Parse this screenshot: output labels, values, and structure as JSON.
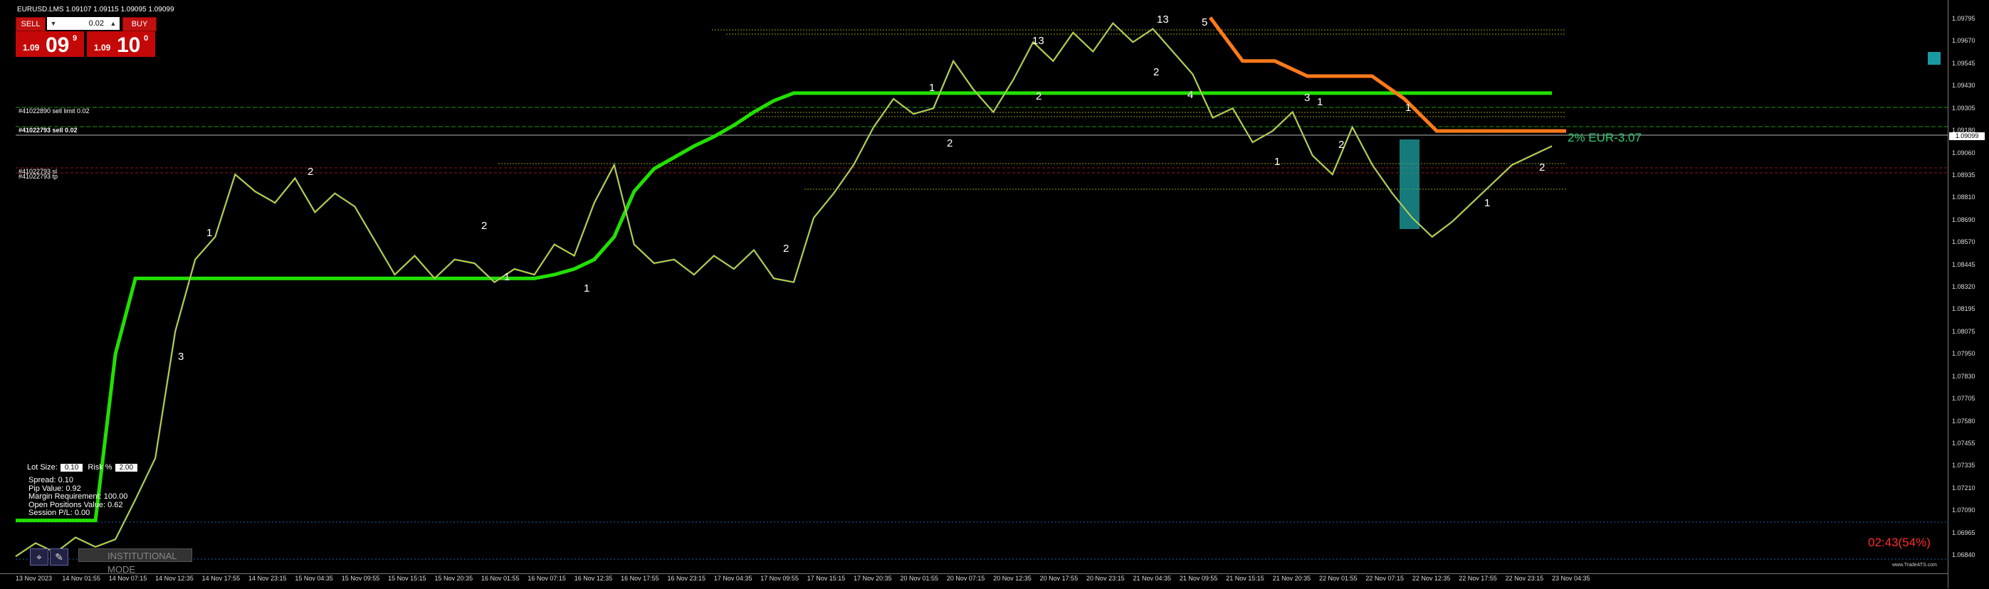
{
  "symbol": "EURUSD.LMS  1.09107 1.09115 1.09095 1.09099",
  "trade_panel": {
    "sell_label": "SELL",
    "buy_label": "BUY",
    "lot_value": "0.02",
    "bid_small": "1.09",
    "bid_big": "09",
    "bid_sup": "9",
    "ask_small": "1.09",
    "ask_big": "10",
    "ask_sup": "0"
  },
  "order_labels": [
    {
      "text": "#41022890 sell limit 0.02"
    },
    {
      "text": "#41022793 sell 0.02"
    },
    {
      "text": "#41022793 sl"
    },
    {
      "text": "#41022793 tp"
    }
  ],
  "risk": {
    "lot_label": "Lot Size:",
    "lot_value": "0.10",
    "risk_label": "Risk %",
    "risk_value": "2.00"
  },
  "info_lines": [
    "Spread: 0.10",
    "Pip Value: 0.92",
    "Margin Requirement: 100.00",
    "Open Positions Value: 0.62",
    "Session P/L: 0.00"
  ],
  "institutional_label": "INSTITUTIONAL MODE",
  "result_label": "2% EUR-3.07",
  "timer": "02:43(54%)",
  "brand": "www.TradeATS.com",
  "current_price": "1.09099",
  "colors": {
    "price": "#f0e000",
    "price_alt": "#1e90ff",
    "trend_green": "#22e000",
    "trend_orange": "#ff7a1a",
    "level_red": "#cc2222",
    "level_cyan": "#1e90ff",
    "level_yellow": "#d8d800",
    "position_box": "#1fa3a3",
    "result_text": "#2ecc71",
    "timer": "#ff2a2a"
  },
  "chart_data": {
    "type": "line",
    "title": "",
    "xlabel": "",
    "ylabel": "",
    "ylim": [
      1.0684,
      1.0982
    ],
    "y_ticks": [
      "1.09795",
      "1.09670",
      "1.09545",
      "1.09430",
      "1.09305",
      "1.09180",
      "1.09060",
      "1.08935",
      "1.08810",
      "1.08690",
      "1.08570",
      "1.08445",
      "1.08320",
      "1.08195",
      "1.08075",
      "1.07950",
      "1.07830",
      "1.07705",
      "1.07580",
      "1.07455",
      "1.07335",
      "1.07210",
      "1.07090",
      "1.06965",
      "1.06840"
    ],
    "x_ticks": [
      "13 Nov 2023",
      "14 Nov 01:55",
      "14 Nov 07:15",
      "14 Nov 12:35",
      "14 Nov 17:55",
      "14 Nov 23:15",
      "15 Nov 04:35",
      "15 Nov 09:55",
      "15 Nov 15:15",
      "15 Nov 20:35",
      "16 Nov 01:55",
      "16 Nov 07:15",
      "16 Nov 12:35",
      "16 Nov 17:55",
      "16 Nov 23:15",
      "17 Nov 04:35",
      "17 Nov 09:55",
      "17 Nov 15:15",
      "17 Nov 20:35",
      "20 Nov 01:55",
      "20 Nov 07:15",
      "20 Nov 12:35",
      "20 Nov 17:55",
      "20 Nov 23:15",
      "21 Nov 04:35",
      "21 Nov 09:55",
      "21 Nov 15:15",
      "21 Nov 20:35",
      "22 Nov 01:55",
      "22 Nov 07:15",
      "22 Nov 12:35",
      "22 Nov 17:55",
      "22 Nov 23:15",
      "23 Nov 04:35"
    ],
    "series": [
      {
        "values": [
          1.0693,
          1.07,
          1.0695,
          1.0703,
          1.0698,
          1.0702,
          1.0723,
          1.0745,
          1.0812,
          1.085,
          1.0862,
          1.0895,
          1.0886,
          1.088,
          1.0893,
          1.0875,
          1.0885,
          1.0878,
          1.086,
          1.0842,
          1.0852,
          1.084,
          1.085,
          1.0848,
          1.0838,
          1.0845,
          1.0842,
          1.0858,
          1.0852,
          1.088,
          1.09,
          1.0858,
          1.0848,
          1.085,
          1.0842,
          1.0852,
          1.0845,
          1.0855,
          1.084,
          1.0838,
          1.0872,
          1.0885,
          1.09,
          1.092,
          1.0935,
          1.0927,
          1.093,
          1.0955,
          1.094,
          1.0928,
          1.0945,
          1.0965,
          1.0955,
          1.097,
          1.096,
          1.0975,
          1.0965,
          1.0972,
          1.096,
          1.0948,
          1.0925,
          1.093,
          1.0912,
          1.0918,
          1.0928,
          1.0905,
          1.0895,
          1.092,
          1.09,
          1.0885,
          1.0872,
          1.0862,
          1.087,
          1.088,
          1.089,
          1.09,
          1.0905,
          1.091
        ]
      },
      {
        "values": [
          1.0712,
          1.0712,
          1.0712,
          1.0712,
          1.0712,
          1.08,
          1.084,
          1.084,
          1.084,
          1.084,
          1.084,
          1.084,
          1.084,
          1.084,
          1.084,
          1.084,
          1.084,
          1.084,
          1.084,
          1.084,
          1.084,
          1.084,
          1.084,
          1.084,
          1.084,
          1.084,
          1.084,
          1.0842,
          1.0845,
          1.085,
          1.0862,
          1.0886,
          1.0898,
          1.0904,
          1.091,
          1.0915,
          1.0921,
          1.0928,
          1.0934,
          1.0938,
          1.0938,
          1.0938,
          1.0938,
          1.0938,
          1.0938,
          1.0938,
          1.0938,
          1.0938,
          1.0938,
          1.0938,
          1.0938,
          1.0938,
          1.0938,
          1.0938,
          1.0938,
          1.0938,
          1.0938,
          1.0938,
          1.0938,
          1.0938,
          1.0938,
          1.0938,
          1.0938,
          1.0938,
          1.0938,
          1.0938,
          1.0938,
          1.0938,
          1.0938,
          1.0938,
          1.0938,
          1.0938,
          1.0938,
          1.0938,
          1.0938,
          1.0938,
          1.0938,
          1.0938
        ]
      },
      {
        "values": [
          1.0978,
          1.0955,
          1.0955,
          1.0947,
          1.0947,
          1.0947,
          1.0935,
          1.0918,
          1.0918,
          1.0918,
          1.0918,
          1.0918
        ]
      }
    ]
  }
}
